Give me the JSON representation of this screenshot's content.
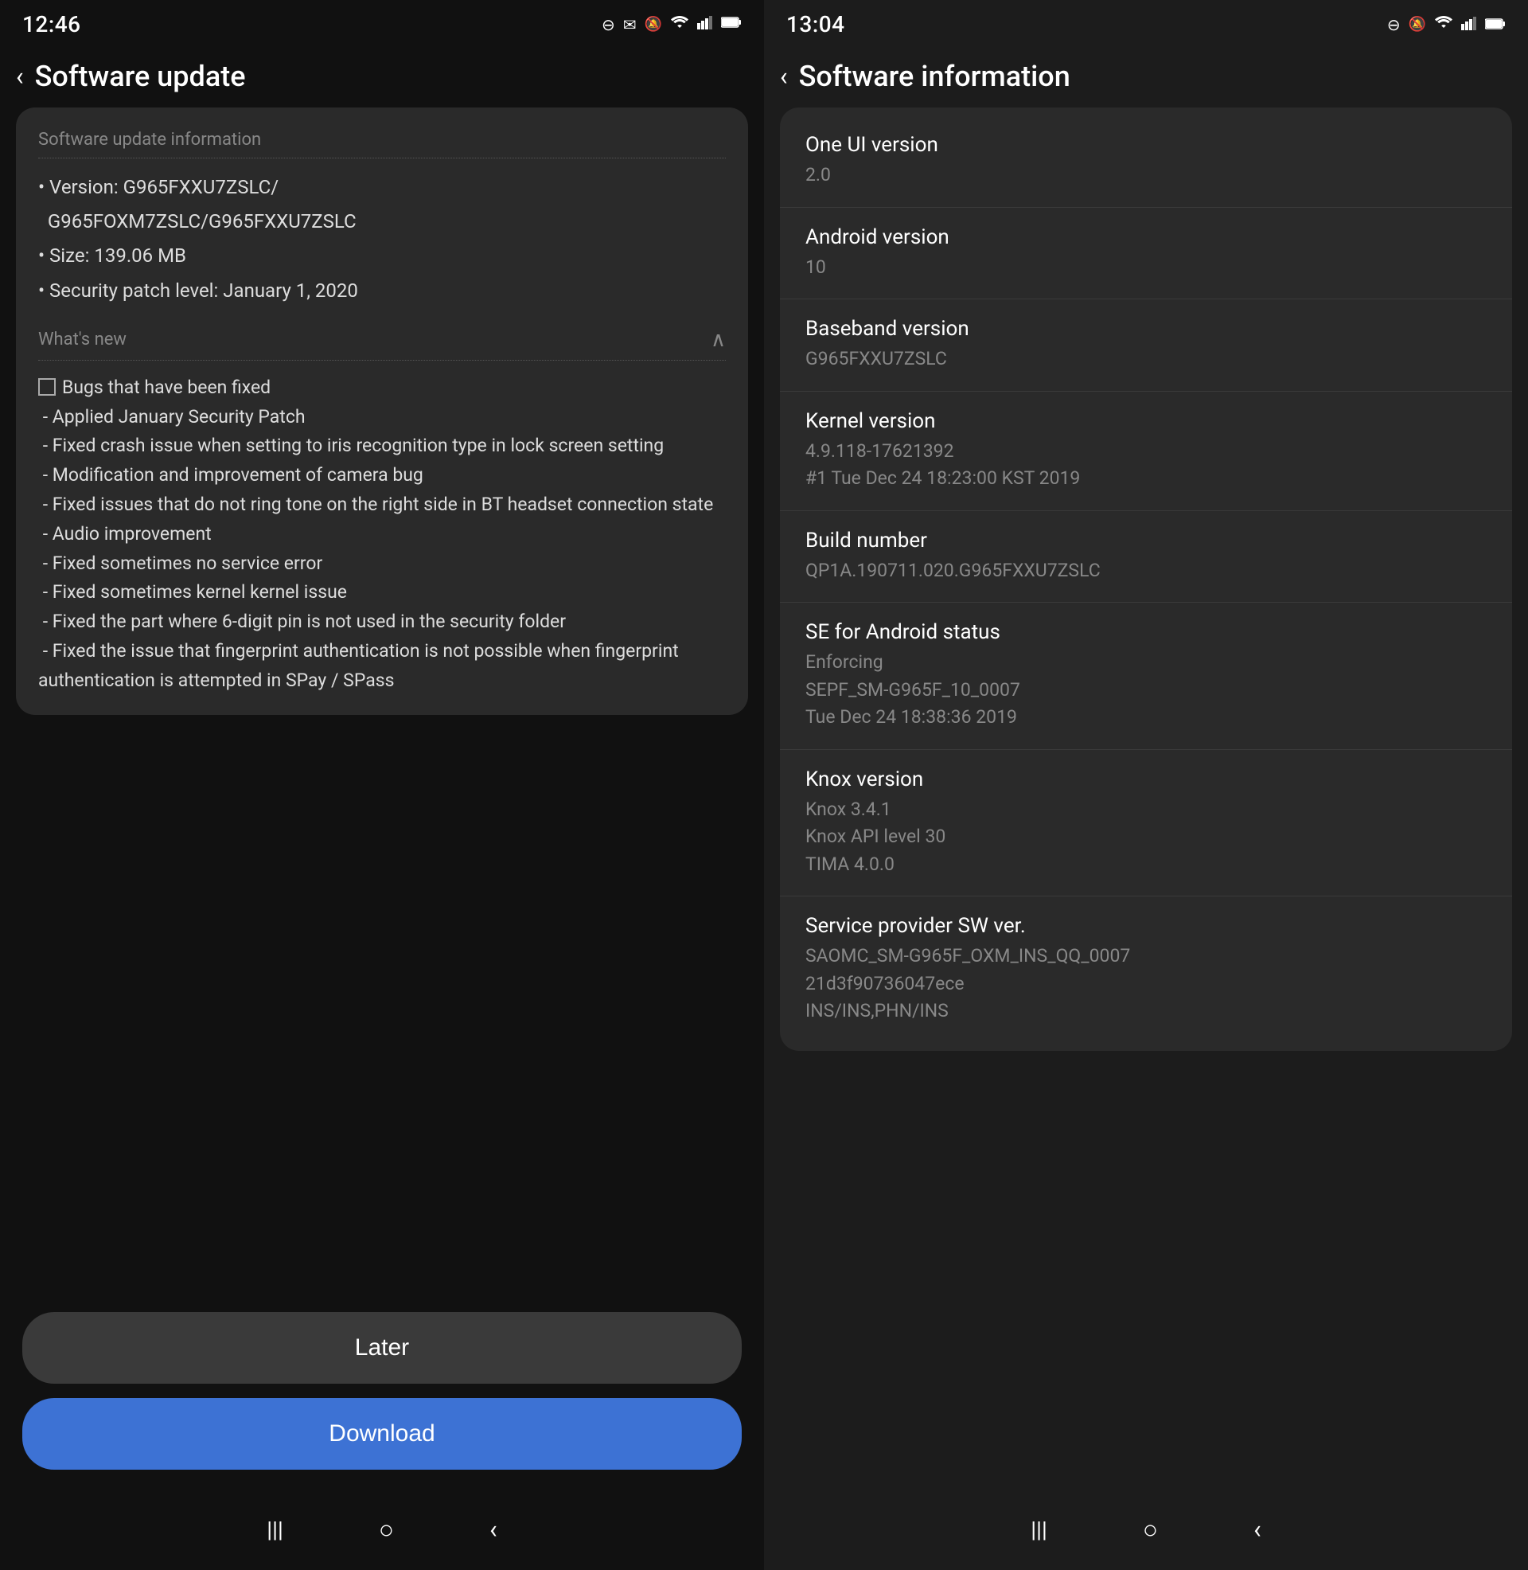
{
  "left": {
    "status": {
      "time": "12:46",
      "icons": [
        "⊖",
        "✉",
        "🔇",
        "📶",
        "📶",
        "🔋"
      ]
    },
    "topBar": {
      "back": "‹",
      "title": "Software update"
    },
    "infoCard": {
      "sectionLabel": "Software update information",
      "lines": [
        "• Version: G965FXXU7ZSLC/",
        "  G965FOXM7ZSLC/G965FXXU7ZSLC",
        "• Size: 139.06 MB",
        "• Security patch level: January 1, 2020"
      ]
    },
    "whatsNew": {
      "label": "What's new",
      "chevron": "∧",
      "changelog": "☐ Bugs that have been fixed\n - Applied January Security Patch\n - Fixed crash issue when setting to iris recognition type in lock screen setting\n - Modification and improvement of camera bug\n - Fixed issues that do not ring tone on the right side in BT headset connection state\n - Audio improvement\n - Fixed sometimes no service error\n - Fixed sometimes kernel kernel issue\n - Fixed the part where 6-digit pin is not used in the security folder\n - Fixed the issue that fingerprint authentication is not possible when fingerprint authentication is attempted in SPay / SPass"
    },
    "buttons": {
      "later": "Later",
      "download": "Download"
    },
    "navBar": {
      "icons": [
        "|||",
        "○",
        "‹"
      ]
    }
  },
  "right": {
    "status": {
      "time": "13:04",
      "icons": [
        "⊖",
        "🔇",
        "📶",
        "📶",
        "🔋"
      ]
    },
    "topBar": {
      "back": "‹",
      "title": "Software information"
    },
    "rows": [
      {
        "label": "One UI version",
        "value": "2.0"
      },
      {
        "label": "Android version",
        "value": "10"
      },
      {
        "label": "Baseband version",
        "value": "G965FXXU7ZSLC"
      },
      {
        "label": "Kernel version",
        "value": "4.9.118-17621392\n#1 Tue Dec 24 18:23:00 KST 2019"
      },
      {
        "label": "Build number",
        "value": "QP1A.190711.020.G965FXXU7ZSLC"
      },
      {
        "label": "SE for Android status",
        "value": "Enforcing\nSEPF_SM-G965F_10_0007\nTue Dec 24 18:38:36 2019"
      },
      {
        "label": "Knox version",
        "value": "Knox 3.4.1\nKnox API level 30\nTIMA 4.0.0"
      },
      {
        "label": "Service provider SW ver.",
        "value": "SAOMC_SM-G965F_OXM_INS_QQ_0007\n21d3f90736047ece\nINS/INS,PHN/INS"
      }
    ],
    "navBar": {
      "icons": [
        "|||",
        "○",
        "‹"
      ]
    }
  }
}
